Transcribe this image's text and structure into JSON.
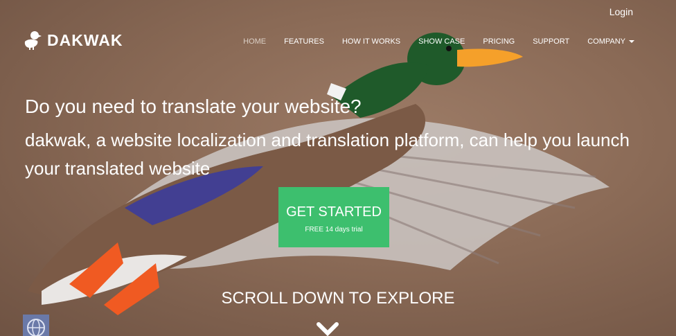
{
  "topbar": {
    "login_label": "Login"
  },
  "brand": {
    "name": "DAKWAK",
    "icon": "duck-icon"
  },
  "nav": {
    "items": [
      {
        "label": "HOME",
        "active": true
      },
      {
        "label": "FEATURES",
        "active": false
      },
      {
        "label": "HOW IT WORKS",
        "active": false
      },
      {
        "label": "SHOW CASE",
        "active": false
      },
      {
        "label": "PRICING",
        "active": false
      },
      {
        "label": "SUPPORT",
        "active": false
      },
      {
        "label": "COMPANY",
        "active": false,
        "dropdown": true
      }
    ]
  },
  "hero": {
    "headline": "Do you need to translate your website?",
    "subline": "dakwak, a website localization and translation platform, can help you launch your translated website",
    "cta_main": "GET STARTED",
    "cta_sub": "FREE 14 days trial",
    "scroll_label": "SCROLL DOWN TO EXPLORE"
  },
  "colors": {
    "cta": "#3dbf6e",
    "text": "#ffffff",
    "background": "#8a6a56"
  },
  "widgets": {
    "language_icon": "globe-icon",
    "scroll_icon": "chevron-down-icon"
  }
}
